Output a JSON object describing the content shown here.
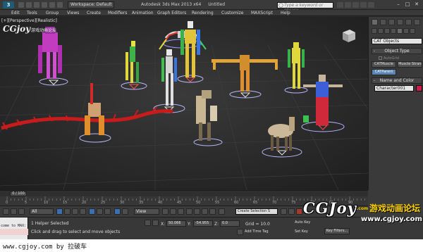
{
  "titlebar": {
    "logo": "3",
    "workspace": "Workspace: Default",
    "app_title": "Autodesk 3ds Max 2013 x64",
    "doc_title": "Untitled",
    "search_placeholder": "Type a keyword or phrase"
  },
  "menubar": {
    "items": [
      "Edit",
      "Tools",
      "Group",
      "Views",
      "Create",
      "Modifiers",
      "Animation",
      "Graph Editors",
      "Rendering",
      "Customize",
      "MAXScript",
      "Help"
    ]
  },
  "viewport": {
    "label": "[+][Perspective][Realistic]",
    "logo_text": "CGjoy",
    "logo_subtitle": "游戏动画论坛"
  },
  "command_panel": {
    "category": "CAT Objects",
    "rollouts": {
      "object_type": "Object Type",
      "name_and_color": "Name and Color"
    },
    "autogrid": "AutoGrid",
    "buttons": [
      "CATMuscle",
      "Muscle Strand",
      "CATParent"
    ],
    "object_name": "Character001",
    "swatch_color": "#d01b4d"
  },
  "timeline": {
    "frame_display": "0 / 100",
    "ticks": [
      "0",
      "5",
      "10",
      "15",
      "20",
      "25",
      "30",
      "35",
      "40",
      "45",
      "50",
      "55",
      "60",
      "65",
      "70",
      "75",
      "80",
      "85",
      "90"
    ]
  },
  "toolbar": {
    "filter": "All",
    "ref_coord": "View",
    "named_selection": "Create Selection S"
  },
  "status": {
    "maxscript_text": "come to MAX:",
    "line1": "1 Helper Selected",
    "line2": "Click and drag to select and move objects",
    "x_label": "X:",
    "x_value": "50.066",
    "y_label": "Y:",
    "y_value": "-54.955",
    "z_label": "Z:",
    "z_value": "0.0",
    "grid": "Grid = 10.0",
    "add_time_tag": "Add Time Tag",
    "auto_key": "Auto Key",
    "set_key": "Set Key",
    "key_filters": "Key Filters..."
  },
  "watermark": {
    "brand": "CGJoy",
    "dotcom": ".com",
    "slogan": "游戏动画论坛",
    "url": "www.cgjoy.com"
  },
  "footer": {
    "text": "www.cgjoy.com by 拉破车"
  }
}
